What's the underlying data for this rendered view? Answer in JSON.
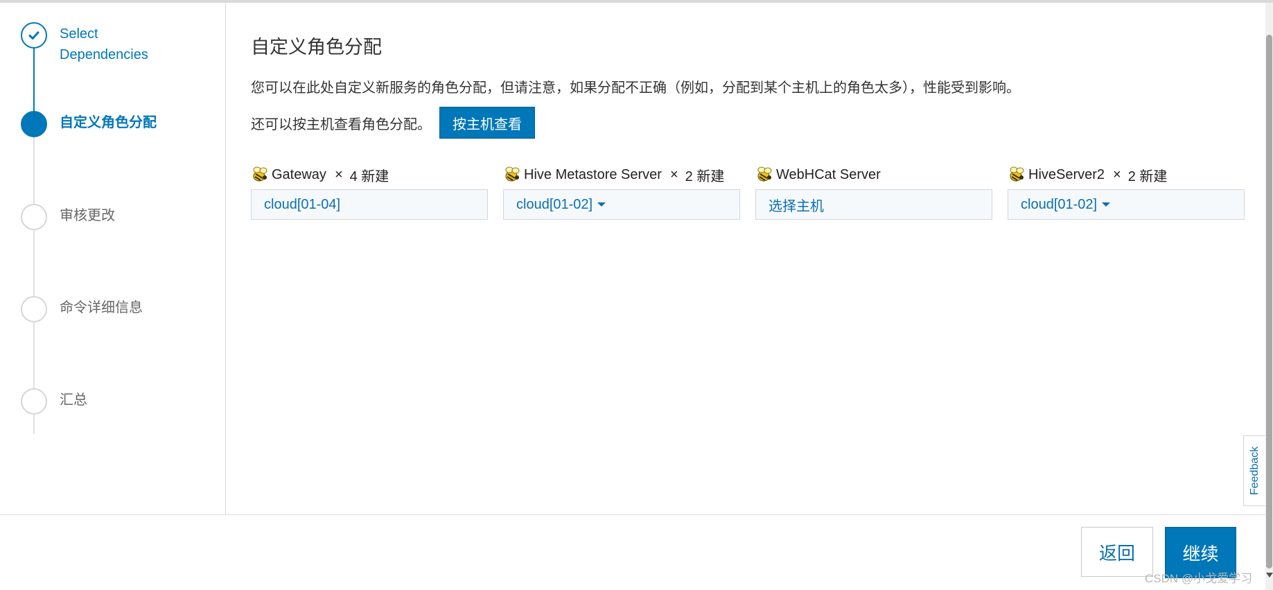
{
  "steps": [
    {
      "label": "Select Dependencies",
      "state": "complete"
    },
    {
      "label": "自定义角色分配",
      "state": "active"
    },
    {
      "label": "审核更改",
      "state": "pending"
    },
    {
      "label": "命令详细信息",
      "state": "pending"
    },
    {
      "label": "汇总",
      "state": "pending"
    }
  ],
  "main": {
    "title": "自定义角色分配",
    "description": "您可以在此处自定义新服务的角色分配，但请注意，如果分配不正确（例如，分配到某个主机上的角色太多），性能受到影响。",
    "host_view_text": "还可以按主机查看角色分配。",
    "host_view_button": "按主机查看"
  },
  "roles": [
    {
      "name": "Gateway",
      "multiplier": "×",
      "count": "4 新建",
      "hosts": "cloud[01-04]",
      "dropdown": false
    },
    {
      "name": "Hive Metastore Server",
      "multiplier": "×",
      "count": "2 新建",
      "hosts": "cloud[01-02]",
      "dropdown": true
    },
    {
      "name": "WebHCat Server",
      "multiplier": "",
      "count": "",
      "hosts": "选择主机",
      "dropdown": false
    },
    {
      "name": "HiveServer2",
      "multiplier": "×",
      "count": "2 新建",
      "hosts": "cloud[01-02]",
      "dropdown": true
    }
  ],
  "feedback_label": "Feedback",
  "footer": {
    "back_label": "返回",
    "continue_label": "继续"
  },
  "watermark": "CSDN @小戈爱学习",
  "colors": {
    "accent": "#0077b8",
    "link": "#0a6fb0",
    "border": "#d9dadb"
  },
  "icons": {
    "check": "check-icon",
    "role": "hive-bee-icon"
  }
}
